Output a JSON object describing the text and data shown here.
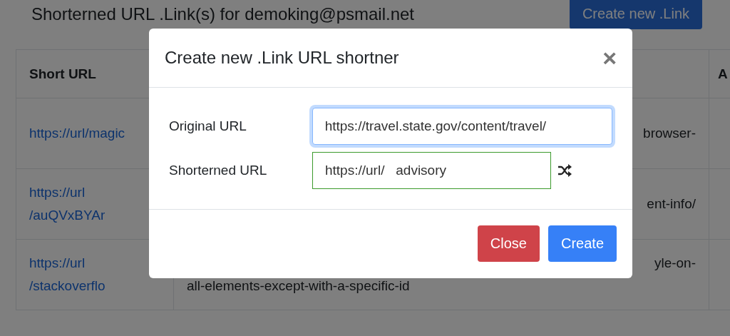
{
  "page": {
    "heading": "Shorterned URL .Link(s) for demoking@psmail.net",
    "create_button": "Create new .Link"
  },
  "table": {
    "header": {
      "short_url": "Short URL",
      "column_3": "A"
    },
    "rows": [
      {
        "short_url": [
          "https://url/magic"
        ],
        "column_2": [
          "browser-"
        ]
      },
      {
        "short_url": [
          "https://url",
          "/auQVxBYAr"
        ],
        "column_2": [
          "ent-info/"
        ]
      },
      {
        "short_url": [
          "https://url",
          "/stackoverflo"
        ],
        "column_2": [
          "yle-on-",
          "all-elements-except-with-a-specific-id"
        ]
      }
    ]
  },
  "modal": {
    "title": "Create new .Link URL shortner",
    "close_symbol": "×",
    "fields": [
      {
        "label": "Original URL",
        "value": "https://travel.state.gov/content/travel/",
        "focused": true,
        "valid": false
      },
      {
        "label": "Shorterned URL",
        "value": "https://url/   advisory",
        "focused": false,
        "valid": true
      }
    ],
    "buttons": [
      {
        "label": "Close",
        "kind": "danger"
      },
      {
        "label": "Create",
        "kind": "primary"
      }
    ]
  }
}
